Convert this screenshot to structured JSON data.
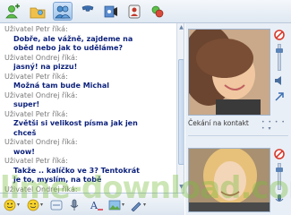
{
  "toolbar": {
    "buttons": [
      {
        "name": "add-contact-icon",
        "color": "#4caf50"
      },
      {
        "name": "share-folder-icon",
        "color": "#e8a92b"
      },
      {
        "name": "webcam-call-icon",
        "color": "#3a6fb0"
      },
      {
        "name": "phone-call-icon",
        "color": "#2a5a9a"
      },
      {
        "name": "media-icon",
        "color": "#3a6fb0"
      },
      {
        "name": "block-contact-icon",
        "color": "#c0392b"
      },
      {
        "name": "games-icon",
        "color": "#4caf50"
      }
    ]
  },
  "chat": {
    "lines": [
      {
        "type": "sender",
        "text": "Uživatel Petr říká:"
      },
      {
        "type": "msg",
        "text": "Dobře, ale vážně, zajdeme na"
      },
      {
        "type": "msg",
        "text": "oběd nebo jak to uděláme?"
      },
      {
        "type": "sender",
        "text": "Uživatel Ondrej říká:"
      },
      {
        "type": "msg",
        "text": "jasný! na pizzu!"
      },
      {
        "type": "sender",
        "text": "Uživatel Petr říká:"
      },
      {
        "type": "msg",
        "text": "Možná tam bude Michal"
      },
      {
        "type": "sender",
        "text": "Uživatel Ondrej říká:"
      },
      {
        "type": "msg",
        "text": "super!"
      },
      {
        "type": "sender",
        "text": "Uživatel Petr říká:"
      },
      {
        "type": "msg",
        "text": "Zvětši si velikost písma jak jen"
      },
      {
        "type": "msg",
        "text": "chceš"
      },
      {
        "type": "sender",
        "text": "Uživatel Ondrej říká:"
      },
      {
        "type": "msg",
        "text": "wow!"
      },
      {
        "type": "sender",
        "text": "Uživatel Petr říká:"
      },
      {
        "type": "msg",
        "text": "Takže .. kalíčko ve 3? Tentokrát"
      },
      {
        "type": "msg",
        "text": "je to, myslím, na tobě"
      },
      {
        "type": "sender",
        "text": "Uživatel Ondrej říká:"
      }
    ]
  },
  "right_panel": {
    "status_label": "Čekání na kontakt"
  },
  "watermark": "lime-download.com"
}
